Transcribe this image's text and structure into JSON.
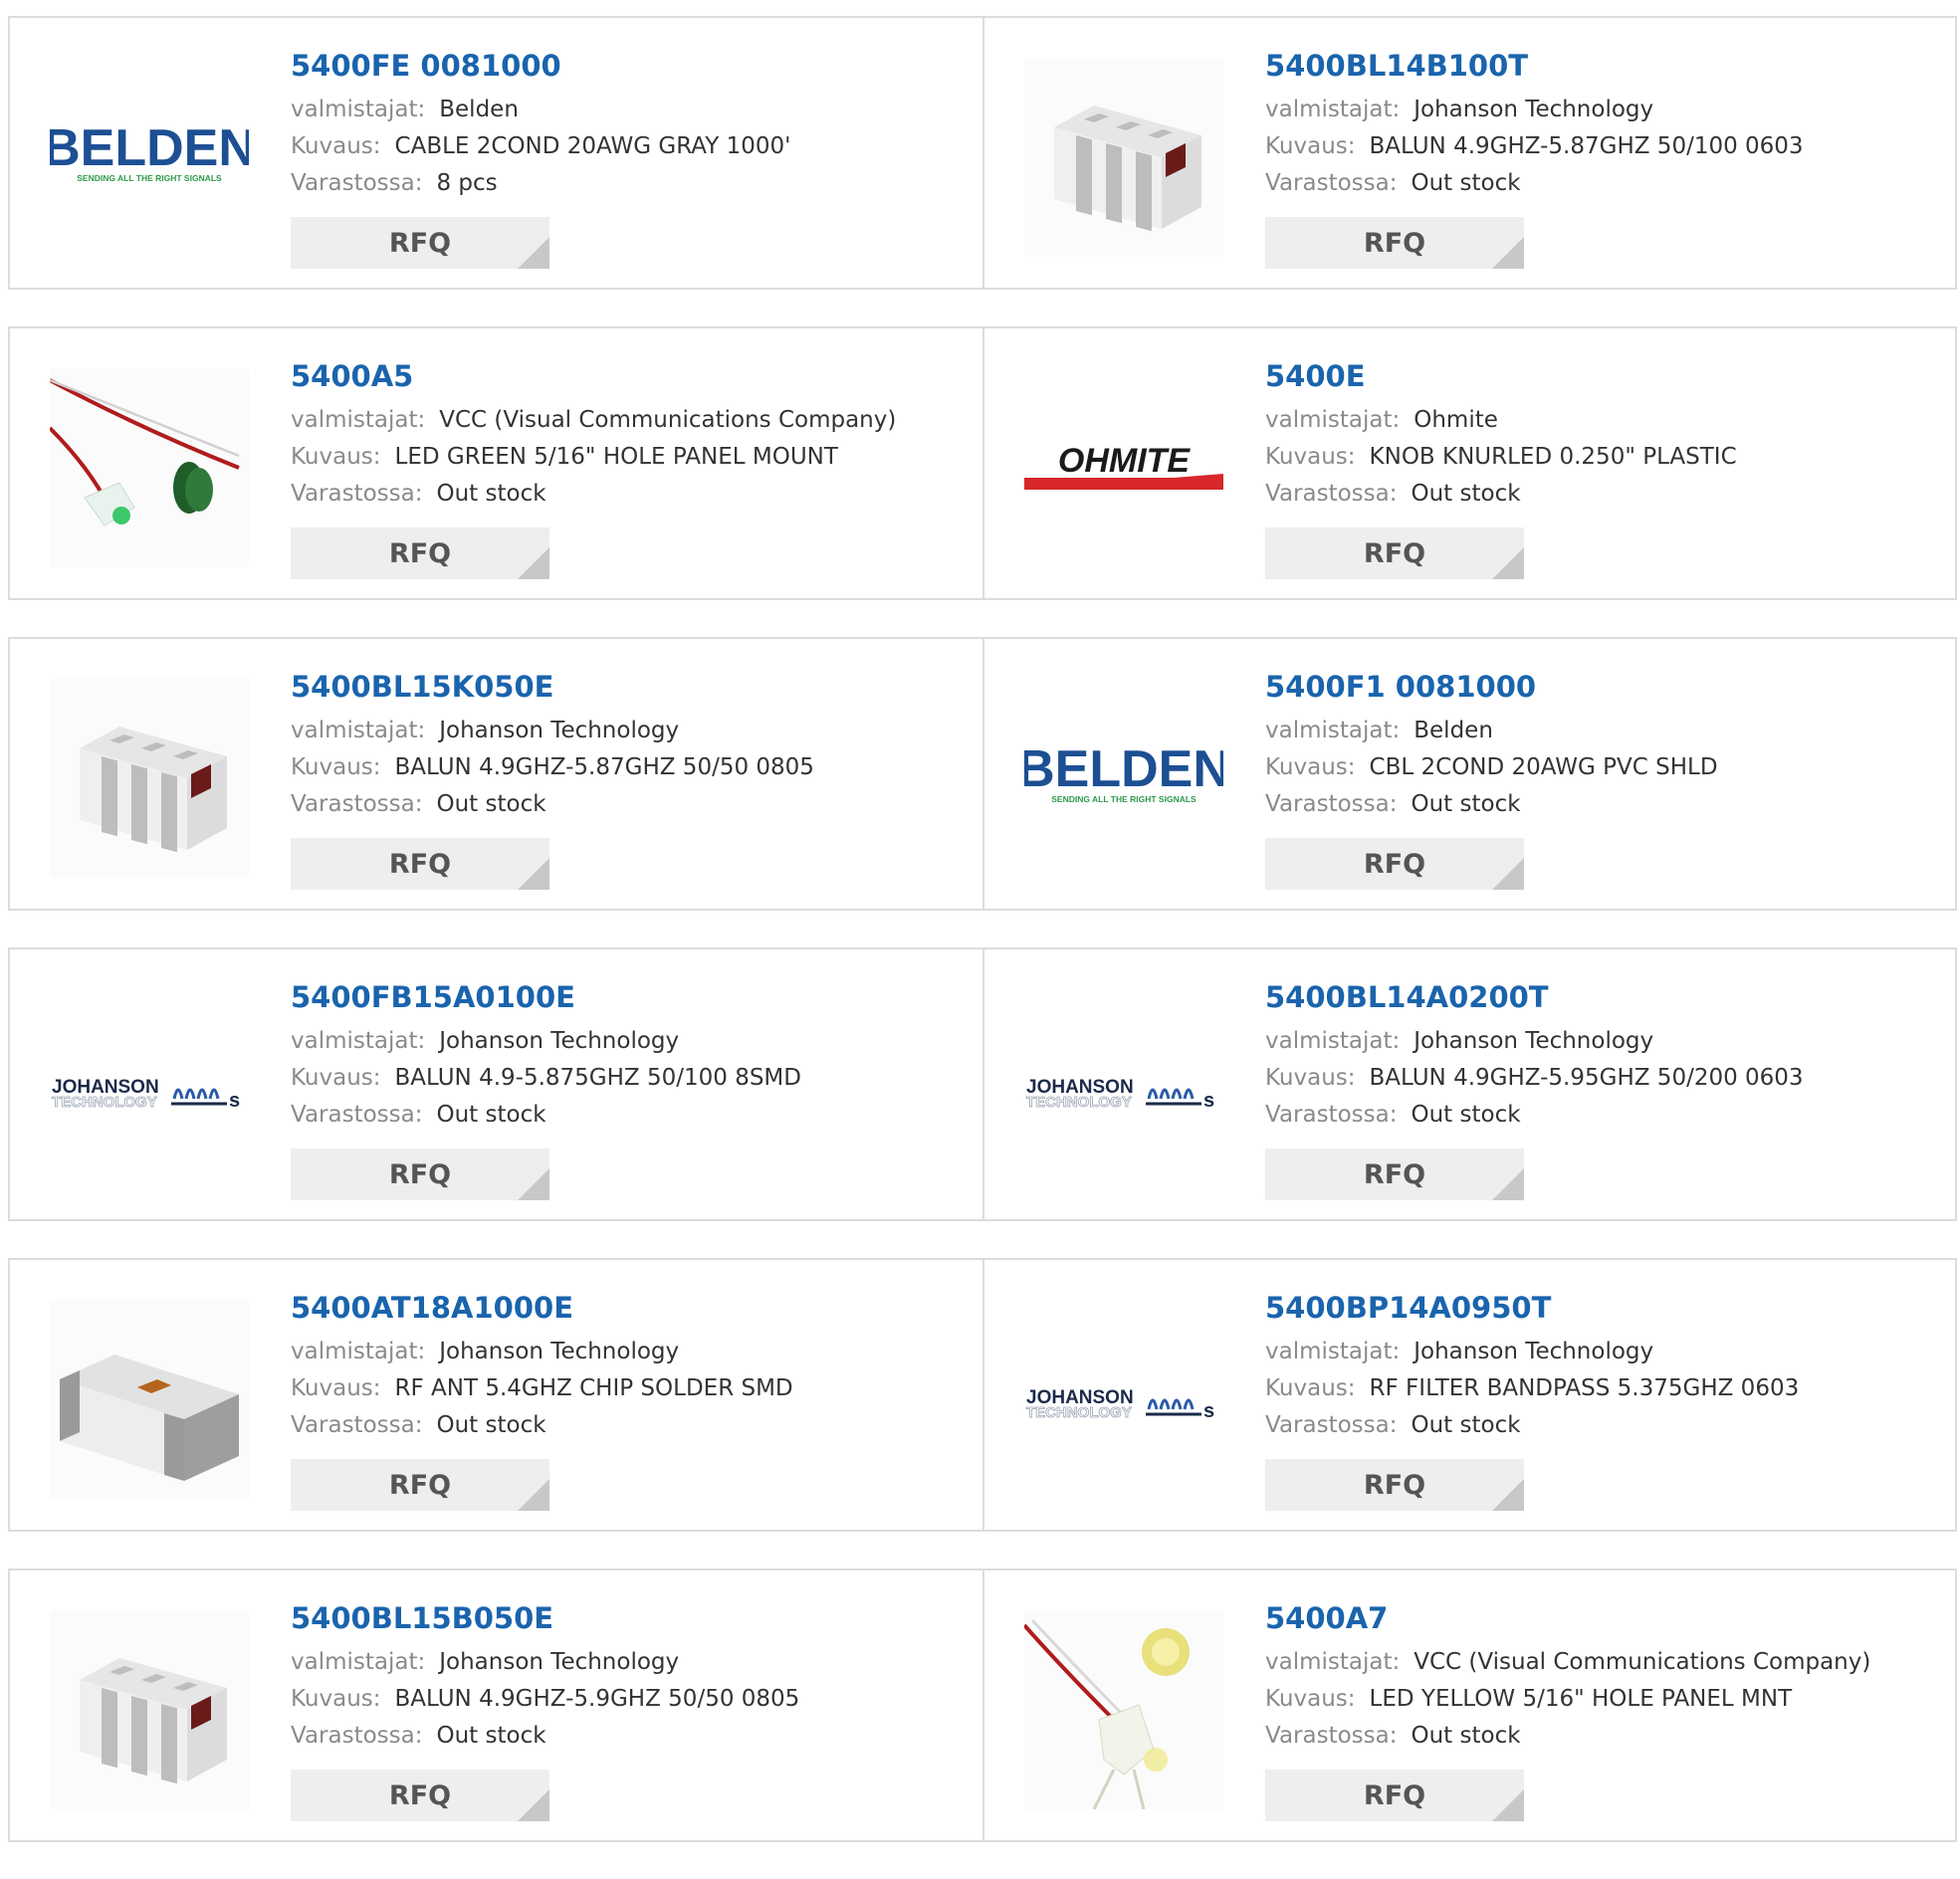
{
  "labels": {
    "manufacturer": "valmistajat:",
    "description": "Kuvaus:",
    "stock": "Varastossa:",
    "rfq": "RFQ"
  },
  "products": [
    {
      "pn": "5400FE 0081000",
      "mfr": "Belden",
      "desc": "CABLE 2COND 20AWG GRAY 1000'",
      "stock": "8 pcs",
      "image": "belden-logo"
    },
    {
      "pn": "5400BL14B100T",
      "mfr": "Johanson Technology",
      "desc": "BALUN 4.9GHZ-5.87GHZ 50/100 0603",
      "stock": "Out stock",
      "image": "balun-chip"
    },
    {
      "pn": "5400A5",
      "mfr": "VCC (Visual Communications Company)",
      "desc": "LED GREEN 5/16\" HOLE PANEL MOUNT",
      "stock": "Out stock",
      "image": "led-green"
    },
    {
      "pn": "5400E",
      "mfr": "Ohmite",
      "desc": "KNOB KNURLED 0.250\" PLASTIC",
      "stock": "Out stock",
      "image": "ohmite-logo"
    },
    {
      "pn": "5400BL15K050E",
      "mfr": "Johanson Technology",
      "desc": "BALUN 4.9GHZ-5.87GHZ 50/50 0805",
      "stock": "Out stock",
      "image": "balun-chip"
    },
    {
      "pn": "5400F1 0081000",
      "mfr": "Belden",
      "desc": "CBL 2COND 20AWG PVC SHLD",
      "stock": "Out stock",
      "image": "belden-logo"
    },
    {
      "pn": "5400FB15A0100E",
      "mfr": "Johanson Technology",
      "desc": "BALUN 4.9-5.875GHZ 50/100 8SMD",
      "stock": "Out stock",
      "image": "johanson-logo"
    },
    {
      "pn": "5400BL14A0200T",
      "mfr": "Johanson Technology",
      "desc": "BALUN 4.9GHZ-5.95GHZ 50/200 0603",
      "stock": "Out stock",
      "image": "johanson-logo"
    },
    {
      "pn": "5400AT18A1000E",
      "mfr": "Johanson Technology",
      "desc": "RF ANT 5.4GHZ CHIP SOLDER SMD",
      "stock": "Out stock",
      "image": "antenna-chip"
    },
    {
      "pn": "5400BP14A0950T",
      "mfr": "Johanson Technology",
      "desc": "RF FILTER BANDPASS 5.375GHZ 0603",
      "stock": "Out stock",
      "image": "johanson-logo"
    },
    {
      "pn": "5400BL15B050E",
      "mfr": "Johanson Technology",
      "desc": "BALUN 4.9GHZ-5.9GHZ 50/50 0805",
      "stock": "Out stock",
      "image": "balun-chip"
    },
    {
      "pn": "5400A7",
      "mfr": "VCC (Visual Communications Company)",
      "desc": "LED YELLOW 5/16\" HOLE PANEL MNT",
      "stock": "Out stock",
      "image": "led-yellow"
    }
  ],
  "logos": {
    "belden": {
      "word": "BELDEN",
      "tagline": "SENDING ALL THE RIGHT SIGNALS",
      "color": "#1c4f93",
      "tagline_color": "#2e9a4a"
    },
    "ohmite": {
      "word": "OHMITE",
      "color": "#d8262b"
    },
    "johanson": {
      "word": "JOHANSON",
      "sub": "TECHNOLOGY",
      "color": "#1b2a4a"
    }
  },
  "colors": {
    "part_number": "#1a64ad",
    "label": "#8a8a8a",
    "value": "#333333",
    "rfq_bg": "#eeeeee",
    "border": "#dcdcdc"
  }
}
